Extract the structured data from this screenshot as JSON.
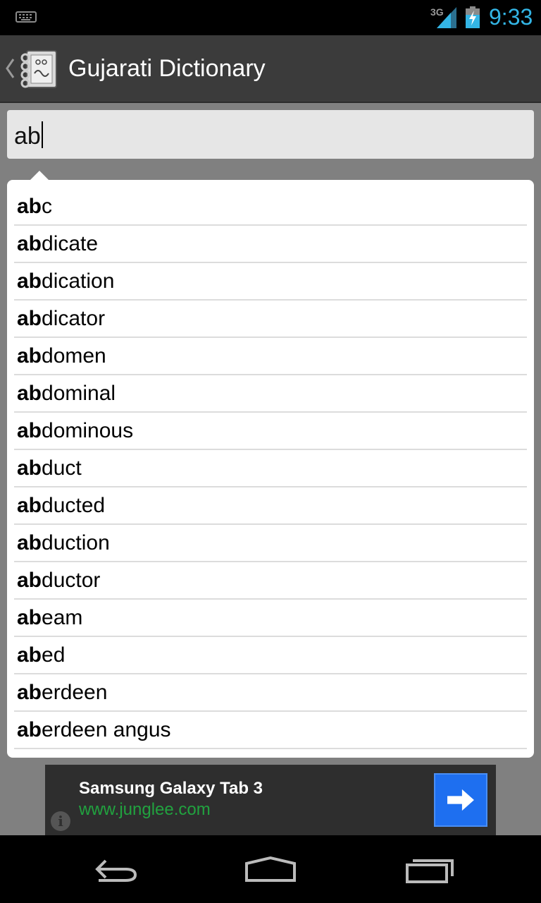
{
  "status_bar": {
    "network": "3G",
    "time": "9:33"
  },
  "action_bar": {
    "title": "Gujarati Dictionary"
  },
  "search": {
    "typed_prefix": "ab"
  },
  "suggestions": [
    {
      "match": "ab",
      "rest": "c"
    },
    {
      "match": "ab",
      "rest": "dicate"
    },
    {
      "match": "ab",
      "rest": "dication"
    },
    {
      "match": "ab",
      "rest": "dicator"
    },
    {
      "match": "ab",
      "rest": "domen"
    },
    {
      "match": "ab",
      "rest": "dominal"
    },
    {
      "match": "ab",
      "rest": "dominous"
    },
    {
      "match": "ab",
      "rest": "duct"
    },
    {
      "match": "ab",
      "rest": "ducted"
    },
    {
      "match": "ab",
      "rest": "duction"
    },
    {
      "match": "ab",
      "rest": "ductor"
    },
    {
      "match": "ab",
      "rest": "eam"
    },
    {
      "match": "ab",
      "rest": "ed"
    },
    {
      "match": "ab",
      "rest": "erdeen"
    },
    {
      "match": "ab",
      "rest": "erdeen angus"
    }
  ],
  "ad": {
    "title": "Samsung Galaxy Tab 3",
    "url": "www.junglee.com",
    "info_icon": "info-icon",
    "arrow_icon": "arrow-right-icon"
  },
  "nav_bar": {
    "buttons": [
      "back-icon",
      "home-icon",
      "recent-apps-icon"
    ]
  },
  "colors": {
    "clock": "#33b5e5",
    "action_bar": "#3b3b3b",
    "ad_url": "#21a23f",
    "ad_button": "#1e6ff0"
  }
}
